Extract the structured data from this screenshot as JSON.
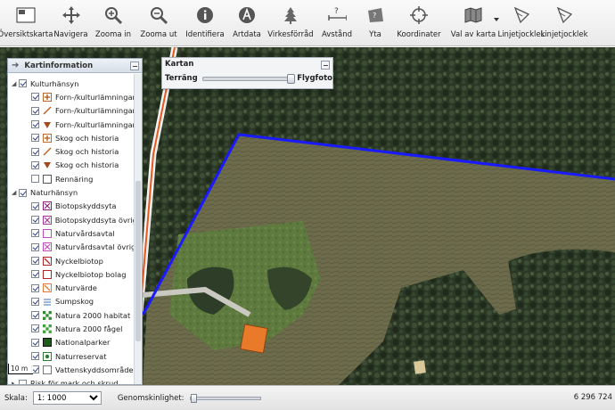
{
  "toolbar": {
    "tools": [
      {
        "label": "Översiktskarta",
        "icon": "overview-map-icon"
      },
      {
        "label": "Navigera",
        "icon": "navigate-arrows-icon"
      },
      {
        "label": "Zooma in",
        "icon": "zoom-in-icon"
      },
      {
        "label": "Zooma ut",
        "icon": "zoom-out-icon"
      },
      {
        "label": "Identifiera",
        "icon": "info-icon"
      },
      {
        "label": "Artdata",
        "icon": "artdata-icon"
      },
      {
        "label": "Virkesförråd",
        "icon": "tree-icon"
      },
      {
        "label": "Avstånd",
        "icon": "distance-icon"
      },
      {
        "label": "Yta",
        "icon": "area-icon"
      },
      {
        "label": "Koordinater",
        "icon": "coordinates-icon"
      },
      {
        "label": "Val av karta",
        "icon": "map-select-icon"
      },
      {
        "label": "Linjetjocklek",
        "icon": "line-width-icon"
      },
      {
        "label": "Linjetjocklek",
        "icon": "line-width-icon"
      }
    ]
  },
  "panel": {
    "title": "Kartinformation",
    "groups": [
      {
        "label": "Kulturhänsyn",
        "checked": true,
        "items": [
          {
            "label": "Forn-/kulturlämningar",
            "symbol": "square-hatched",
            "color": "#b8642a"
          },
          {
            "label": "Forn-/kulturlämningar",
            "symbol": "line",
            "color": "#c0622b"
          },
          {
            "label": "Forn-/kulturlämningar",
            "symbol": "triangle",
            "color": "#a24a1c"
          },
          {
            "label": "Skog och historia",
            "symbol": "square-hatched",
            "color": "#c06a2e"
          },
          {
            "label": "Skog och historia",
            "symbol": "line",
            "color": "#c0622b"
          },
          {
            "label": "Skog och historia",
            "symbol": "triangle",
            "color": "#a24a1c"
          },
          {
            "label": "Rennäring",
            "symbol": "square-empty",
            "color": "#555555",
            "checked": false
          }
        ]
      },
      {
        "label": "Naturhänsyn",
        "checked": true,
        "items": [
          {
            "label": "Biotopskyddsyta",
            "symbol": "square-x",
            "color": "#8a1f7a"
          },
          {
            "label": "Biotopskyddsyta övriga",
            "symbol": "square-x",
            "color": "#a2399a"
          },
          {
            "label": "Naturvårdsavtal",
            "symbol": "square-empty",
            "color": "#c04dbf"
          },
          {
            "label": "Naturvårdsavtal övriga",
            "symbol": "square-x",
            "color": "#c04dbf"
          },
          {
            "label": "Nyckelbiotop",
            "symbol": "square-slash",
            "color": "#b0242a"
          },
          {
            "label": "Nyckelbiotop bolag",
            "symbol": "square-empty",
            "color": "#b0242a"
          },
          {
            "label": "Naturvärde",
            "symbol": "square-slash",
            "color": "#e07a3a"
          },
          {
            "label": "Sumpskog",
            "symbol": "lines",
            "color": "#3a6fb5"
          },
          {
            "label": "Natura 2000 habitat",
            "symbol": "checker",
            "color": "#2e8b2e"
          },
          {
            "label": "Natura 2000 fågel",
            "symbol": "checker",
            "color": "#3aa53a"
          },
          {
            "label": "Nationalparker",
            "symbol": "square-filled",
            "color": "#1f5a1f"
          },
          {
            "label": "Naturreservat",
            "symbol": "square-dot",
            "color": "#2e7d32"
          },
          {
            "label": "Vattenskyddsområde",
            "symbol": "square-empty",
            "color": "#777777"
          }
        ]
      },
      {
        "label": "Risk för mark och skrud",
        "checked": false,
        "items": []
      }
    ]
  },
  "kartan": {
    "title": "Kartan",
    "left_label": "Terräng",
    "right_label": "Flygfoto",
    "level": 0.95
  },
  "scalebar": {
    "label": "10 m"
  },
  "status": {
    "scale_label": "Skala:",
    "scale_value": "1: 1000",
    "transparency_label": "Genomskinlighet:",
    "transparency": 0,
    "coordinate": "6 296 724"
  },
  "colors": {
    "boundary": "#1a1aff",
    "road": "#e85a1e",
    "field": "#6e6a4a",
    "forest": "#243020",
    "roof": "#e87a2a"
  }
}
